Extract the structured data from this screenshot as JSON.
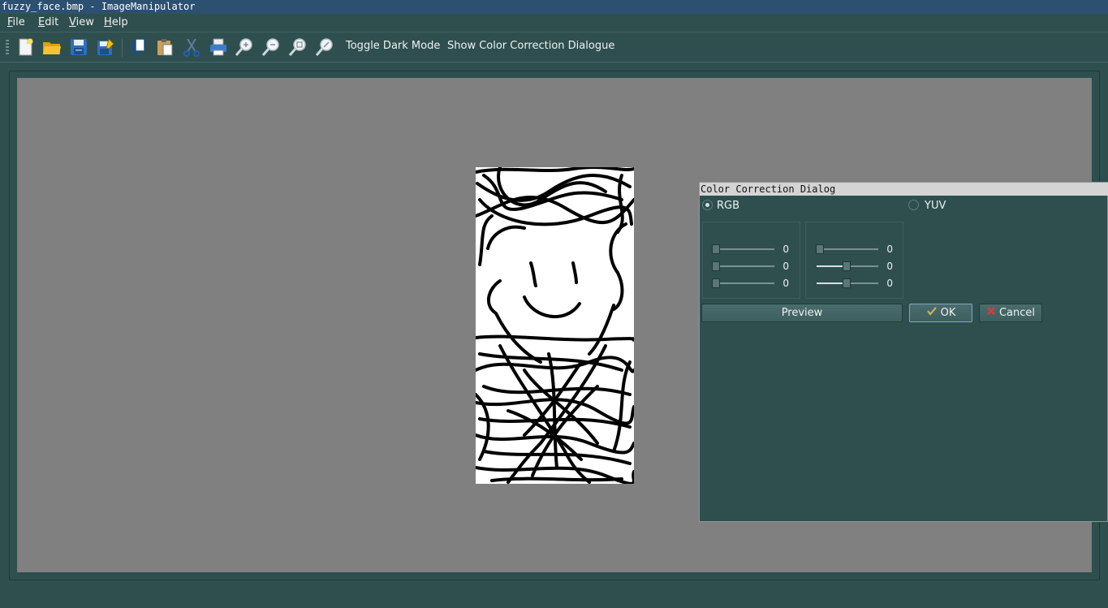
{
  "window": {
    "title": "fuzzy_face.bmp - ImageManipulator"
  },
  "menu": [
    {
      "mnemonic": "F",
      "rest": "ile"
    },
    {
      "mnemonic": "E",
      "rest": "dit"
    },
    {
      "mnemonic": "V",
      "rest": "iew"
    },
    {
      "mnemonic": "H",
      "rest": "elp"
    }
  ],
  "toolbar": {
    "icons": [
      "new-file-icon",
      "open-folder-icon",
      "save-icon",
      "save-as-icon",
      "copy-icon",
      "paste-icon",
      "cut-icon",
      "print-icon",
      "zoom-in-icon",
      "zoom-out-icon",
      "zoom-fit-icon",
      "zoom-reset-icon"
    ],
    "toggle_dark_mode": "Toggle Dark Mode",
    "show_color_correction": "Show Color Correction Dialogue"
  },
  "image": {
    "name": "fuzzy_face.bmp"
  },
  "dialog": {
    "title": "Color Correction Dialog",
    "rgb_label": "RGB",
    "yuv_label": "YUV",
    "selected_mode": "RGB",
    "rgb_values": [
      "0",
      "0",
      "0"
    ],
    "yuv_values": [
      "0",
      "0",
      "0"
    ],
    "yuv_slider_fraction": [
      0.0,
      0.5,
      0.5
    ],
    "preview_label": "Preview",
    "ok_label": "OK",
    "cancel_label": "Cancel"
  },
  "colors": {
    "background": "#2f4f4f",
    "canvas": "#808080",
    "titlebar": "#2b5070"
  }
}
